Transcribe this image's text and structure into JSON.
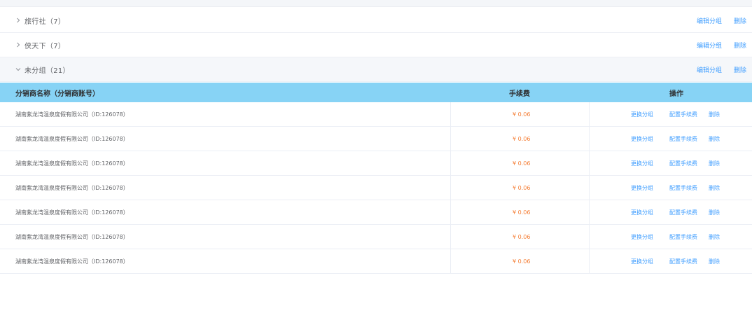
{
  "groups": [
    {
      "name": "旅行社（7）",
      "edit_label": "编辑分组",
      "delete_label": "删除",
      "expanded": false
    },
    {
      "name": "侠天下（7）",
      "edit_label": "编辑分组",
      "delete_label": "删除",
      "expanded": false
    },
    {
      "name": "未分组（21）",
      "edit_label": "编辑分组",
      "delete_label": "删除",
      "expanded": true
    }
  ],
  "table": {
    "headers": {
      "name": "分销商名称（分销商账号）",
      "fee": "手续费",
      "operations": "操作"
    },
    "rows": [
      {
        "name": "湖南紫龙湾温泉度假有限公司（ID:126078）",
        "fee": "¥ 0.06",
        "change_group": "更换分组",
        "config_fee": "配置手续费",
        "delete": "删除"
      },
      {
        "name": "湖南紫龙湾温泉度假有限公司（ID:126078）",
        "fee": "¥ 0.06",
        "change_group": "更换分组",
        "config_fee": "配置手续费",
        "delete": "删除"
      },
      {
        "name": "湖南紫龙湾温泉度假有限公司（ID:126078）",
        "fee": "¥ 0.06",
        "change_group": "更换分组",
        "config_fee": "配置手续费",
        "delete": "删除"
      },
      {
        "name": "湖南紫龙湾温泉度假有限公司（ID:126078）",
        "fee": "¥ 0.06",
        "change_group": "更换分组",
        "config_fee": "配置手续费",
        "delete": "删除"
      },
      {
        "name": "湖南紫龙湾温泉度假有限公司（ID:126078）",
        "fee": "¥ 0.06",
        "change_group": "更换分组",
        "config_fee": "配置手续费",
        "delete": "删除"
      },
      {
        "name": "湖南紫龙湾温泉度假有限公司（ID:126078）",
        "fee": "¥ 0.06",
        "change_group": "更换分组",
        "config_fee": "配置手续费",
        "delete": "删除"
      },
      {
        "name": "湖南紫龙湾温泉度假有限公司（ID:126078）",
        "fee": "¥ 0.06",
        "change_group": "更换分组",
        "config_fee": "配置手续费",
        "delete": "删除"
      }
    ]
  },
  "colors": {
    "header_bg": "#87d3f5",
    "link": "#409eff",
    "fee": "#f5813a",
    "group_expanded_bg": "#f5f7fa"
  },
  "icons": {
    "collapsed": "chevron-right-icon",
    "expanded": "chevron-down-icon"
  }
}
